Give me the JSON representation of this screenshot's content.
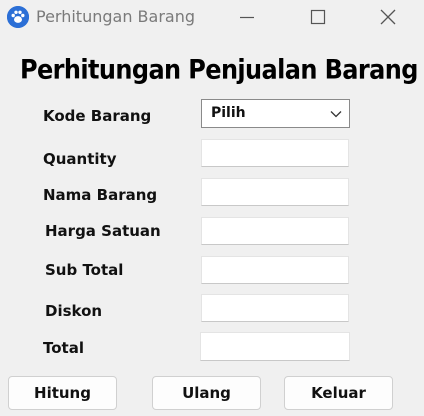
{
  "window": {
    "title": "Perhitungan Barang",
    "icon": "paw-icon",
    "controls": [
      "minimize-icon",
      "maximize-icon",
      "close-icon"
    ]
  },
  "form": {
    "heading": "Perhitungan Penjualan Barang",
    "fields": {
      "kode_barang": {
        "label": "Kode Barang",
        "selected": "Pilih"
      },
      "quantity": {
        "label": "Quantity",
        "value": ""
      },
      "nama_barang": {
        "label": "Nama Barang",
        "value": ""
      },
      "harga_satuan": {
        "label": "Harga Satuan",
        "value": ""
      },
      "sub_total": {
        "label": "Sub Total",
        "value": ""
      },
      "diskon": {
        "label": "Diskon",
        "value": ""
      },
      "total": {
        "label": "Total",
        "value": ""
      }
    }
  },
  "buttons": {
    "hitung": "Hitung",
    "ulang": "Ulang",
    "keluar": "Keluar"
  },
  "colors": {
    "background": "#f0f0f0",
    "icon_blue": "#2b6fd6",
    "title_text": "#7a7a7a"
  }
}
